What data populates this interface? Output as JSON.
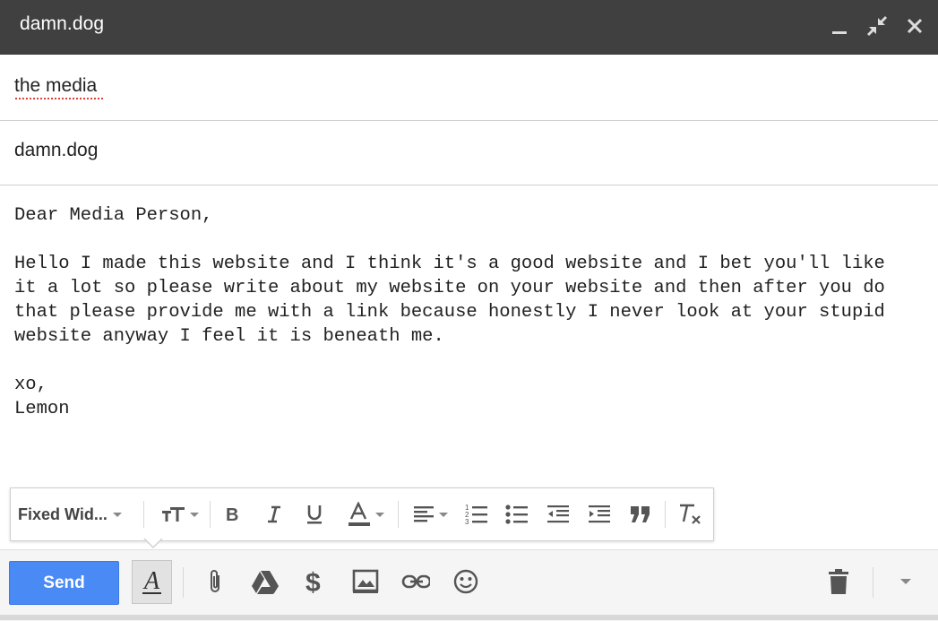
{
  "window": {
    "title": "damn.dog"
  },
  "compose": {
    "to": "the media",
    "subject": "damn.dog",
    "body_lines": [
      "Dear Media Person,",
      "",
      "Hello I made this website and I think it's a good website and I bet you'll like",
      "it a lot so please write about my website on your website and then after you do",
      "that please provide me with a link because honestly I never look at your stupid",
      "website anyway I feel it is beneath me.",
      "",
      "xo,",
      "Lemon"
    ]
  },
  "format_toolbar": {
    "font_label": "Fixed Wid...",
    "icons": [
      "text-size-icon",
      "bold-icon",
      "italic-icon",
      "underline-icon",
      "text-color-icon",
      "align-icon",
      "numbered-list-icon",
      "bulleted-list-icon",
      "indent-less-icon",
      "indent-more-icon",
      "quote-icon",
      "remove-formatting-icon"
    ]
  },
  "actions": {
    "send_label": "Send",
    "icons": [
      "formatting-toggle-icon",
      "attach-icon",
      "drive-icon",
      "money-icon",
      "photo-icon",
      "link-icon",
      "emoji-icon",
      "trash-icon",
      "more-options-icon"
    ]
  },
  "colors": {
    "titlebar": "#404040",
    "send_button": "#4a8af4",
    "spell_underline": "#d93025"
  }
}
